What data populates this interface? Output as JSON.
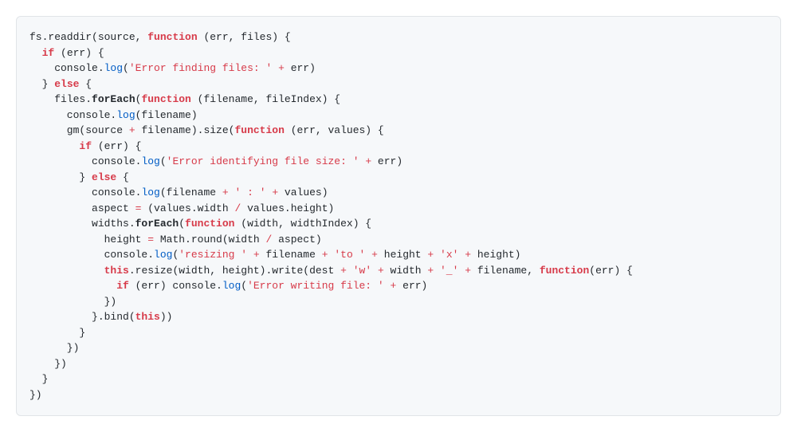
{
  "code": {
    "tokens": [
      [
        [
          "p",
          "fs.readdir(source, "
        ],
        [
          "kw",
          "function"
        ],
        [
          "p",
          " (err, files) {"
        ]
      ],
      [
        [
          "p",
          "  "
        ],
        [
          "kw",
          "if"
        ],
        [
          "p",
          " (err) {"
        ]
      ],
      [
        [
          "p",
          "    console."
        ],
        [
          "fn",
          "log"
        ],
        [
          "p",
          "("
        ],
        [
          "st",
          "'Error finding files: '"
        ],
        [
          "p",
          " "
        ],
        [
          "op",
          "+"
        ],
        [
          "p",
          " err)"
        ]
      ],
      [
        [
          "p",
          "  } "
        ],
        [
          "kw",
          "else"
        ],
        [
          "p",
          " {"
        ]
      ],
      [
        [
          "p",
          "    files."
        ],
        [
          "kn",
          "forEach"
        ],
        [
          "p",
          "("
        ],
        [
          "kw",
          "function"
        ],
        [
          "p",
          " (filename, fileIndex) {"
        ]
      ],
      [
        [
          "p",
          "      console."
        ],
        [
          "fn",
          "log"
        ],
        [
          "p",
          "(filename)"
        ]
      ],
      [
        [
          "p",
          "      gm(source "
        ],
        [
          "op",
          "+"
        ],
        [
          "p",
          " filename).size("
        ],
        [
          "kw",
          "function"
        ],
        [
          "p",
          " (err, values) {"
        ]
      ],
      [
        [
          "p",
          "        "
        ],
        [
          "kw",
          "if"
        ],
        [
          "p",
          " (err) {"
        ]
      ],
      [
        [
          "p",
          "          console."
        ],
        [
          "fn",
          "log"
        ],
        [
          "p",
          "("
        ],
        [
          "st",
          "'Error identifying file size: '"
        ],
        [
          "p",
          " "
        ],
        [
          "op",
          "+"
        ],
        [
          "p",
          " err)"
        ]
      ],
      [
        [
          "p",
          "        } "
        ],
        [
          "kw",
          "else"
        ],
        [
          "p",
          " {"
        ]
      ],
      [
        [
          "p",
          "          console."
        ],
        [
          "fn",
          "log"
        ],
        [
          "p",
          "(filename "
        ],
        [
          "op",
          "+"
        ],
        [
          "p",
          " "
        ],
        [
          "st",
          "' : '"
        ],
        [
          "p",
          " "
        ],
        [
          "op",
          "+"
        ],
        [
          "p",
          " values)"
        ]
      ],
      [
        [
          "p",
          "          aspect "
        ],
        [
          "op",
          "="
        ],
        [
          "p",
          " (values.width "
        ],
        [
          "op",
          "/"
        ],
        [
          "p",
          " values.height)"
        ]
      ],
      [
        [
          "p",
          "          widths."
        ],
        [
          "kn",
          "forEach"
        ],
        [
          "p",
          "("
        ],
        [
          "kw",
          "function"
        ],
        [
          "p",
          " (width, widthIndex) {"
        ]
      ],
      [
        [
          "p",
          "            height "
        ],
        [
          "op",
          "="
        ],
        [
          "p",
          " Math.round(width "
        ],
        [
          "op",
          "/"
        ],
        [
          "p",
          " aspect)"
        ]
      ],
      [
        [
          "p",
          "            console."
        ],
        [
          "fn",
          "log"
        ],
        [
          "p",
          "("
        ],
        [
          "st",
          "'resizing '"
        ],
        [
          "p",
          " "
        ],
        [
          "op",
          "+"
        ],
        [
          "p",
          " filename "
        ],
        [
          "op",
          "+"
        ],
        [
          "p",
          " "
        ],
        [
          "st",
          "'to '"
        ],
        [
          "p",
          " "
        ],
        [
          "op",
          "+"
        ],
        [
          "p",
          " height "
        ],
        [
          "op",
          "+"
        ],
        [
          "p",
          " "
        ],
        [
          "st",
          "'x'"
        ],
        [
          "p",
          " "
        ],
        [
          "op",
          "+"
        ],
        [
          "p",
          " height)"
        ]
      ],
      [
        [
          "p",
          "            "
        ],
        [
          "kw",
          "this"
        ],
        [
          "p",
          ".resize(width, height).write(dest "
        ],
        [
          "op",
          "+"
        ],
        [
          "p",
          " "
        ],
        [
          "st",
          "'w'"
        ],
        [
          "p",
          " "
        ],
        [
          "op",
          "+"
        ],
        [
          "p",
          " width "
        ],
        [
          "op",
          "+"
        ],
        [
          "p",
          " "
        ],
        [
          "st",
          "'_'"
        ],
        [
          "p",
          " "
        ],
        [
          "op",
          "+"
        ],
        [
          "p",
          " filename, "
        ],
        [
          "kw",
          "function"
        ],
        [
          "p",
          "(err) {"
        ]
      ],
      [
        [
          "p",
          "              "
        ],
        [
          "kw",
          "if"
        ],
        [
          "p",
          " (err) console."
        ],
        [
          "fn",
          "log"
        ],
        [
          "p",
          "("
        ],
        [
          "st",
          "'Error writing file: '"
        ],
        [
          "p",
          " "
        ],
        [
          "op",
          "+"
        ],
        [
          "p",
          " err)"
        ]
      ],
      [
        [
          "p",
          "            })"
        ]
      ],
      [
        [
          "p",
          "          }.bind("
        ],
        [
          "kw",
          "this"
        ],
        [
          "p",
          "))"
        ]
      ],
      [
        [
          "p",
          "        }"
        ]
      ],
      [
        [
          "p",
          "      })"
        ]
      ],
      [
        [
          "p",
          "    })"
        ]
      ],
      [
        [
          "p",
          "  }"
        ]
      ],
      [
        [
          "p",
          "})"
        ]
      ]
    ]
  }
}
